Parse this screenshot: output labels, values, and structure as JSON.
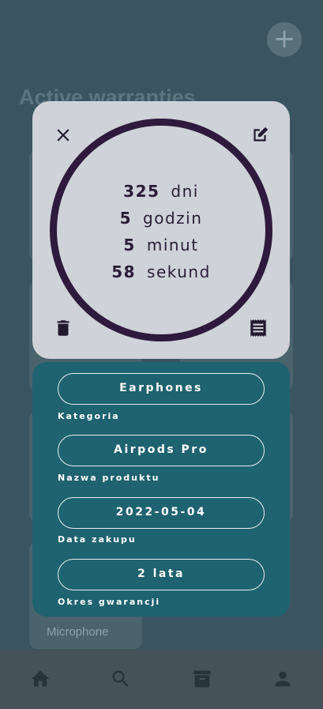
{
  "background": {
    "title": "Active warranties",
    "add_icon": "plus-icon",
    "visible_card_label": "Microphone"
  },
  "timer": {
    "close_icon": "close-icon",
    "edit_icon": "edit-icon",
    "delete_icon": "trash-icon",
    "receipt_icon": "receipt-icon",
    "days_value": "325",
    "days_unit": "dni",
    "hours_value": "5",
    "hours_unit": "godzin",
    "minutes_value": "5",
    "minutes_unit": "minut",
    "seconds_value": "58",
    "seconds_unit": "sekund"
  },
  "details": {
    "category_value": "Earphones",
    "category_label": "Kategoria",
    "product_value": "Airpods Pro",
    "product_label": "Nazwa produktu",
    "purchase_date_value": "2022-05-04",
    "purchase_date_label": "Data zakupu",
    "warranty_period_value": "2 lata",
    "warranty_period_label": "Okres gwarancji"
  },
  "nav": {
    "items": [
      "home-icon",
      "search-icon",
      "archive-icon",
      "account-icon"
    ]
  },
  "colors": {
    "timer_card_bg": "#cfd2d8",
    "ring": "#2e1a3c",
    "info_panel_bg": "#1f6270"
  }
}
